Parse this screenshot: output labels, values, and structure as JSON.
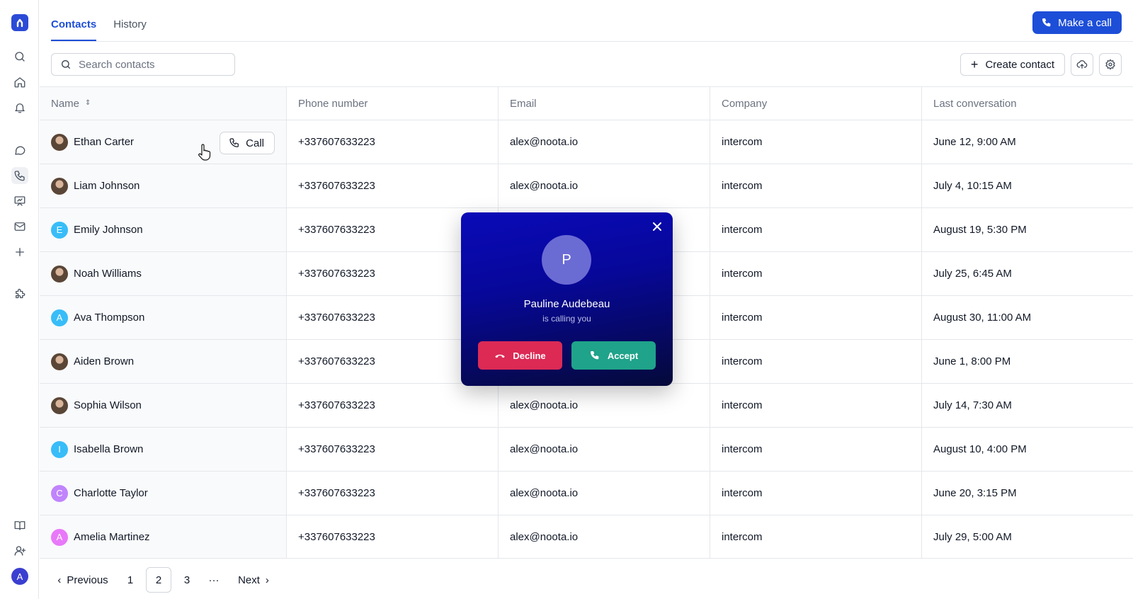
{
  "sidebar": {
    "items": [
      {
        "icon": "logo-icon"
      },
      {
        "icon": "search-icon"
      },
      {
        "icon": "home-icon"
      },
      {
        "icon": "bell-icon"
      },
      {
        "icon": "chat-icon"
      },
      {
        "icon": "phone-icon"
      },
      {
        "icon": "presentation-icon"
      },
      {
        "icon": "mail-icon"
      },
      {
        "icon": "plus-icon"
      },
      {
        "icon": "puzzle-icon"
      },
      {
        "icon": "book-icon"
      },
      {
        "icon": "user-plus-icon"
      }
    ],
    "user_initial": "A"
  },
  "tabs": [
    {
      "label": "Contacts",
      "active": true
    },
    {
      "label": "History",
      "active": false
    }
  ],
  "header": {
    "make_call_label": "Make a call"
  },
  "toolbar": {
    "search_placeholder": "Search contacts",
    "create_contact_label": "Create contact"
  },
  "table": {
    "columns": [
      "Name",
      "Phone number",
      "Email",
      "Company",
      "Last conversation"
    ],
    "call_label": "Call",
    "rows": [
      {
        "name": "Ethan Carter",
        "avatar": "photo",
        "phone": "+337607633223",
        "email": "alex@noota.io",
        "company": "intercom",
        "last": "June 12, 9:00 AM"
      },
      {
        "name": "Liam Johnson",
        "avatar": "photo",
        "phone": "+337607633223",
        "email": "alex@noota.io",
        "company": "intercom",
        "last": "July 4, 10:15 AM"
      },
      {
        "name": "Emily Johnson",
        "avatar": "E",
        "avatar_color": "#38bdf8",
        "phone": "+337607633223",
        "email": "",
        "company": "intercom",
        "last": "August 19, 5:30 PM"
      },
      {
        "name": "Noah Williams",
        "avatar": "photo",
        "phone": "+337607633223",
        "email": "",
        "company": "intercom",
        "last": "July 25, 6:45 AM"
      },
      {
        "name": "Ava Thompson",
        "avatar": "A",
        "avatar_color": "#38bdf8",
        "phone": "+337607633223",
        "email": "",
        "company": "intercom",
        "last": "August 30, 11:00 AM"
      },
      {
        "name": "Aiden Brown",
        "avatar": "photo",
        "phone": "+337607633223",
        "email": "",
        "company": "intercom",
        "last": "June 1, 8:00 PM"
      },
      {
        "name": "Sophia Wilson",
        "avatar": "photo",
        "phone": "+337607633223",
        "email": "alex@noota.io",
        "company": "intercom",
        "last": "July 14, 7:30 AM"
      },
      {
        "name": "Isabella Brown",
        "avatar": "I",
        "avatar_color": "#38bdf8",
        "phone": "+337607633223",
        "email": "alex@noota.io",
        "company": "intercom",
        "last": "August 10, 4:00 PM"
      },
      {
        "name": "Charlotte Taylor",
        "avatar": "C",
        "avatar_color": "#c084fc",
        "phone": "+337607633223",
        "email": "alex@noota.io",
        "company": "intercom",
        "last": "June 20, 3:15 PM"
      },
      {
        "name": "Amelia Martinez",
        "avatar": "A",
        "avatar_color": "#e879f9",
        "phone": "+337607633223",
        "email": "alex@noota.io",
        "company": "intercom",
        "last": "July 29, 5:00 AM"
      }
    ]
  },
  "pagination": {
    "previous_label": "Previous",
    "pages": [
      "1",
      "2",
      "3"
    ],
    "current_page": "2",
    "ellipsis": "···",
    "next_label": "Next"
  },
  "incoming_call": {
    "initial": "P",
    "caller_name": "Pauline Audebeau",
    "subtitle": "is calling you",
    "decline_label": "Decline",
    "accept_label": "Accept"
  },
  "colors": {
    "accent": "#1d4ed8",
    "decline": "#dc2a55",
    "accept": "#1fa38a"
  }
}
